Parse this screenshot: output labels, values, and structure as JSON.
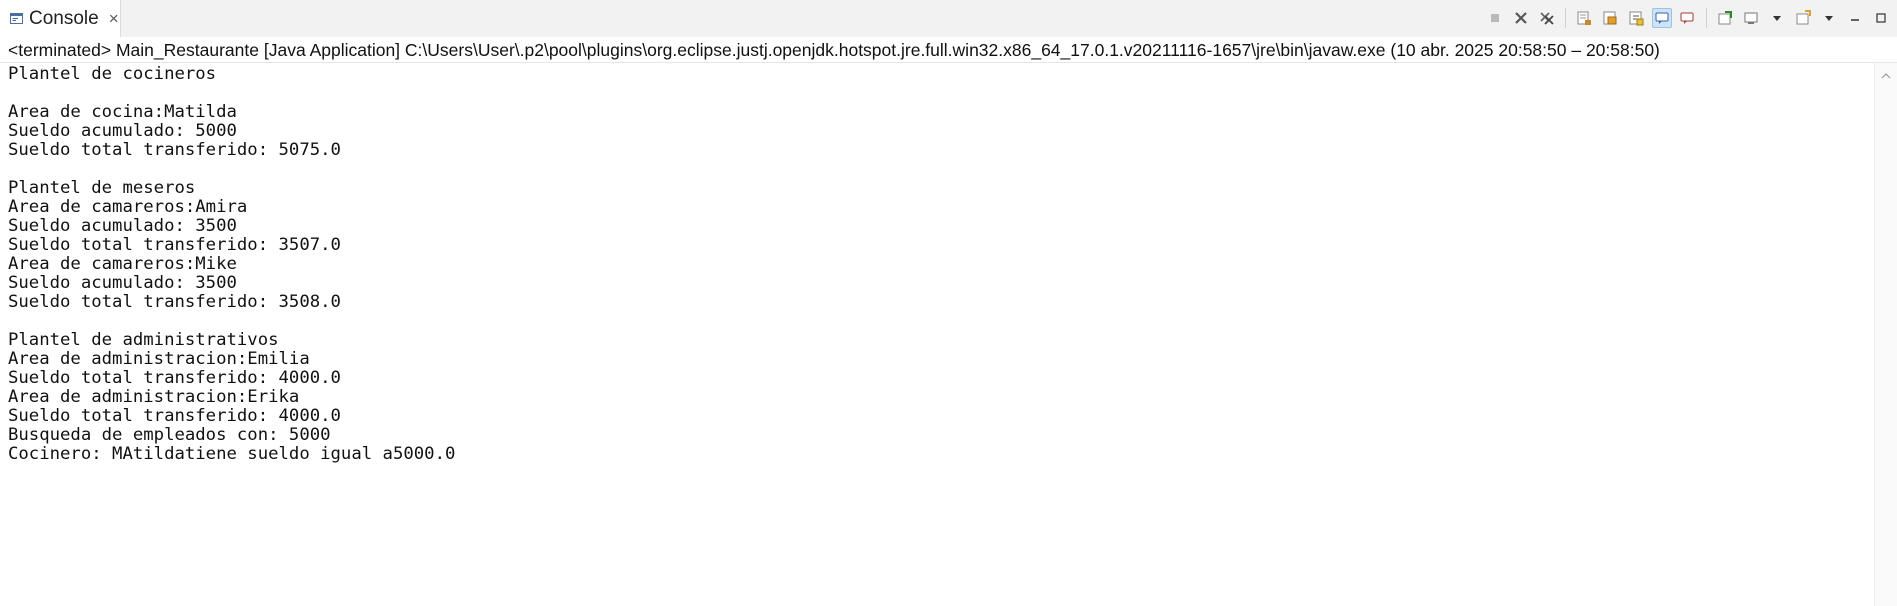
{
  "tab": {
    "icon": "console-icon",
    "label": "Console",
    "close": "×"
  },
  "toolbar": {
    "icons": [
      "terminate-icon",
      "remove-launch-icon",
      "remove-all-terminated-icon",
      "clear-console-icon",
      "scroll-lock-icon",
      "word-wrap-icon",
      "show-on-stdout-icon",
      "show-on-stderr-icon",
      "pin-console-icon",
      "display-selected-console-icon",
      "open-console-icon",
      "minimize-icon",
      "maximize-icon"
    ]
  },
  "status": {
    "text": "<terminated> Main_Restaurante [Java Application] C:\\Users\\User\\.p2\\pool\\plugins\\org.eclipse.justj.openjdk.hotspot.jre.full.win32.x86_64_17.0.1.v20211116-1657\\jre\\bin\\javaw.exe  (10 abr. 2025 20:58:50 – 20:58:50)"
  },
  "console": {
    "lines": [
      "Plantel de cocineros",
      "",
      "Area de cocina:Matilda",
      "Sueldo acumulado: 5000",
      "Sueldo total transferido: 5075.0",
      "",
      "Plantel de meseros",
      "Area de camareros:Amira",
      "Sueldo acumulado: 3500",
      "Sueldo total transferido: 3507.0",
      "Area de camareros:Mike",
      "Sueldo acumulado: 3500",
      "Sueldo total transferido: 3508.0",
      "",
      "Plantel de administrativos",
      "Area de administracion:Emilia",
      "Sueldo total transferido: 4000.0",
      "Area de administracion:Erika",
      "Sueldo total transferido: 4000.0",
      "Busqueda de empleados con: 5000",
      "Cocinero: MAtildatiene sueldo igual a5000.0"
    ]
  },
  "colors": {
    "accent": "#2b6cb0",
    "text": "#111111",
    "background": "#ffffff"
  }
}
